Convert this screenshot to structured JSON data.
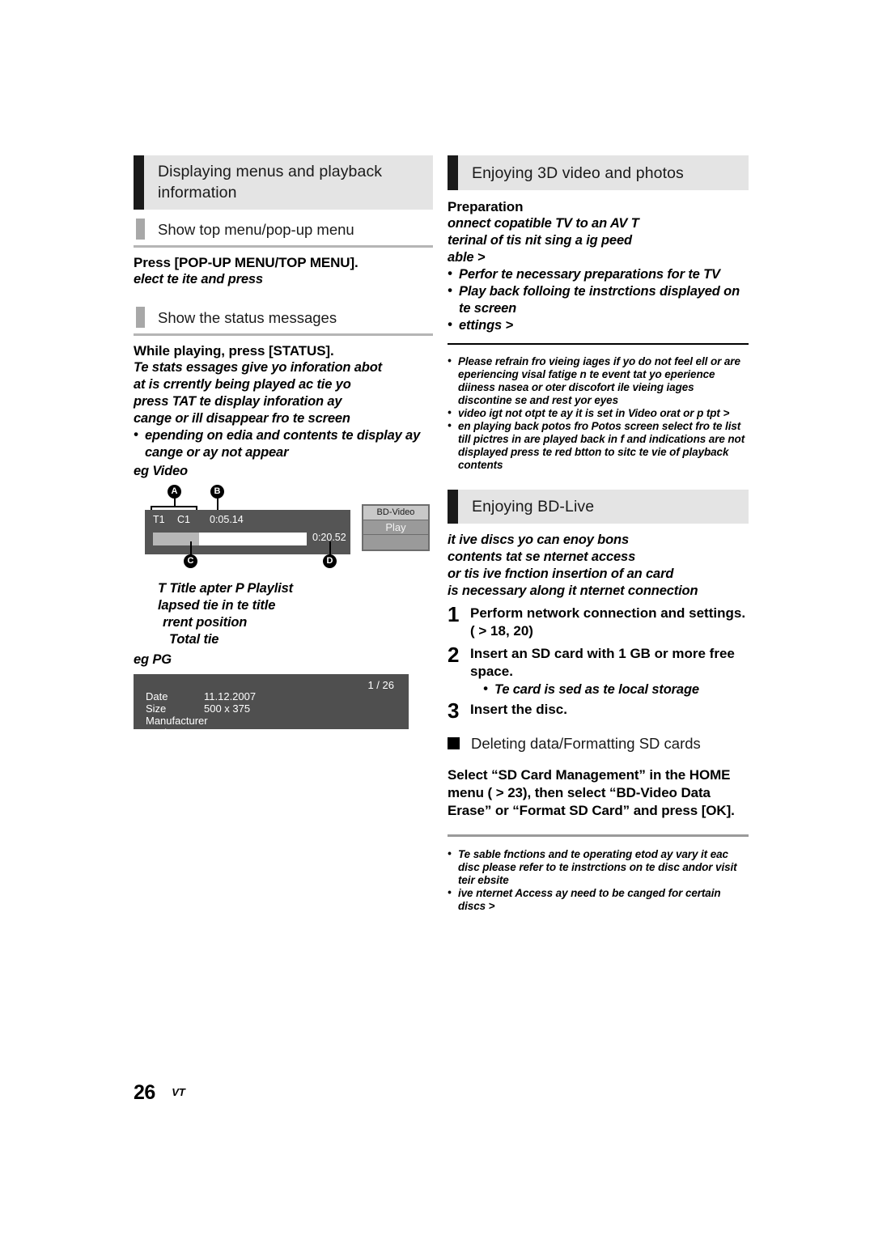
{
  "page": {
    "number": "26",
    "code": "VT"
  },
  "left": {
    "section1": {
      "title": "Displaying menus and playback information",
      "sub1": {
        "title": "Show top menu/pop-up menu",
        "bold_line": "Press [POP-UP MENU/TOP MENU].",
        "italic_line": "elect te ite and press"
      },
      "sub2": {
        "title": "Show the status messages",
        "bold_line": "While playing, press [STATUS].",
        "italic_lines": [
          "Te stats essages give yo inforation abot",
          "at is crrently being played ac tie yo",
          "press TAT te display inforation ay",
          "cange or ill disappear fro te screen"
        ],
        "bullets": [
          "epending on edia and contents te display ay cange or ay not appear"
        ],
        "eg_video_label": "eg Video",
        "eg_jpeg_label": "eg PG"
      }
    },
    "video_osd": {
      "title": "T1",
      "chapter": "C1",
      "elapsed": "0:05.14",
      "total": "0:20.52",
      "side_panel": {
        "disc_type": "BD-Video",
        "status": "Play",
        "extra": ""
      },
      "callouts": [
        "A",
        "B",
        "C",
        "D"
      ],
      "legend": [
        "T Title  apter P Playlist",
        "lapsed tie in te title",
        "rrent position",
        "Total tie"
      ]
    },
    "jpeg_osd": {
      "count": "1 / 26",
      "rows": [
        {
          "label": "Date",
          "value": "11.12.2007"
        },
        {
          "label": "Size",
          "value": "500 x 375"
        },
        {
          "label": "Manufacturer",
          "value": ""
        },
        {
          "label": "Equipment",
          "value": ""
        }
      ]
    }
  },
  "right": {
    "section_3d": {
      "title": "Enjoying 3D video and photos",
      "prep_label": "Preparation",
      "prep_lines": [
        "onnect  copatible TV to an  AV T",
        "terinal of tis nit sing a ig peed",
        "able         >"
      ],
      "prep_bullets": [
        "Perfor te necessary preparations for te TV",
        "Play back folloing te instrctions displayed on te screen",
        " ettings          >"
      ],
      "notes": [
        "Please refrain fro vieing  iages if yo do not feel ell or are eperiencing visal fatige n te event tat yo eperience diiness nasea or oter discofort ile vieing  iages discontine se and rest yor eyes",
        " video igt not otpt te ay it is set in  Video orat or p tpt                    >",
        "en playing back  potos fro Potos screen select fro te  list till pictres in  are played back in  f and  indications are not displayed press te red btton to sitc te vie of playback contents"
      ]
    },
    "section_bdlive": {
      "title": "Enjoying BD-Live",
      "intro_lines": [
        "it ive discs yo can enoy bons",
        "contents tat se nternet access",
        "or tis ive fnction insertion of an  card",
        "is necessary along it nternet connection"
      ],
      "steps": [
        {
          "num": "1",
          "text": "Perform network connection and settings.",
          "sub": "( >  18, 20)",
          "bullets": []
        },
        {
          "num": "2",
          "text": "Insert an SD card with 1 GB or more free space.",
          "sub": "",
          "bullets": [
            "Te  card is sed as te local storage"
          ]
        },
        {
          "num": "3",
          "text": "Insert the disc.",
          "sub": "",
          "bullets": []
        }
      ],
      "subsection": {
        "title": "Deleting data/Formatting SD cards",
        "body_lines": [
          "Select “SD Card Management” in the HOME",
          "menu ( >  23), then select “BD-Video Data",
          "Erase” or “Format SD Card” and press [OK]."
        ]
      },
      "notes": [
        "Te sable fnctions and te operating etod ay vary it eac disc please refer to te instrctions on te disc andor visit teir ebsite",
        "ive nternet Access ay need to be canged for certain discs >"
      ]
    }
  }
}
